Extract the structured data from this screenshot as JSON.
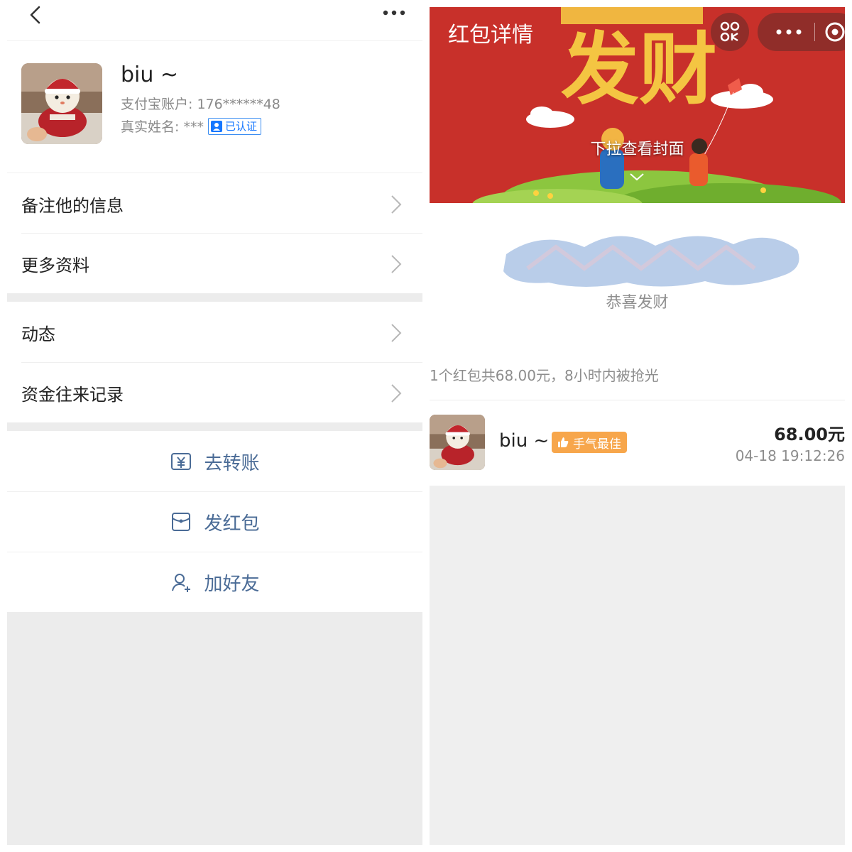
{
  "left": {
    "header": {
      "back_icon": "chevron-left-icon",
      "more_icon": "more-dots-icon"
    },
    "profile": {
      "name": "biu ~",
      "account": "支付宝账户: 176******48",
      "real_name": "真实姓名: ***",
      "verified_badge": "已认证"
    },
    "rows": [
      {
        "label": "备注他的信息"
      },
      {
        "label": "更多资料"
      },
      {
        "label": "动态"
      },
      {
        "label": "资金往来记录"
      }
    ],
    "actions": [
      {
        "label": "去转账",
        "icon": "yuan-transfer-icon"
      },
      {
        "label": "发红包",
        "icon": "red-envelope-icon"
      },
      {
        "label": "加好友",
        "icon": "add-friend-icon"
      }
    ]
  },
  "right": {
    "banner": {
      "title": "红包详情",
      "pull_hint": "下拉查看封面",
      "colors": {
        "background": "#c8302a",
        "headline": "#f4c542"
      }
    },
    "greeting": "恭喜发财",
    "summary": "1个红包共68.00元，8小时内被抢光",
    "record": {
      "name": "biu ~",
      "badge": "手气最佳",
      "amount": "68.00元",
      "time": "04-18 19:12:26"
    }
  }
}
